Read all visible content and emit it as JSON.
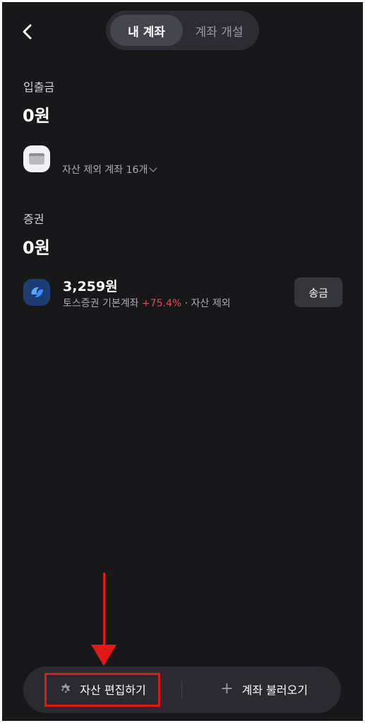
{
  "header": {
    "tabs": [
      {
        "label": "내 계좌",
        "active": true
      },
      {
        "label": "계좌 개설",
        "active": false
      }
    ]
  },
  "deposit_section": {
    "title": "입출금",
    "total": "0원",
    "excluded_link": "자산 제외 계좌 16개"
  },
  "securities_section": {
    "title": "증권",
    "total": "0원",
    "account": {
      "amount": "3,259원",
      "name": "토스증권 기본계좌",
      "change": "+75.4%",
      "separator": "·",
      "status": "자산 제외",
      "action": "송금"
    }
  },
  "bottom_bar": {
    "edit_label": "자산 편집하기",
    "import_label": "계좌 불러오기"
  },
  "colors": {
    "background": "#18181b",
    "positive": "#f04452",
    "annotation": "#e01818",
    "toss_blue": "#3d8bff"
  }
}
